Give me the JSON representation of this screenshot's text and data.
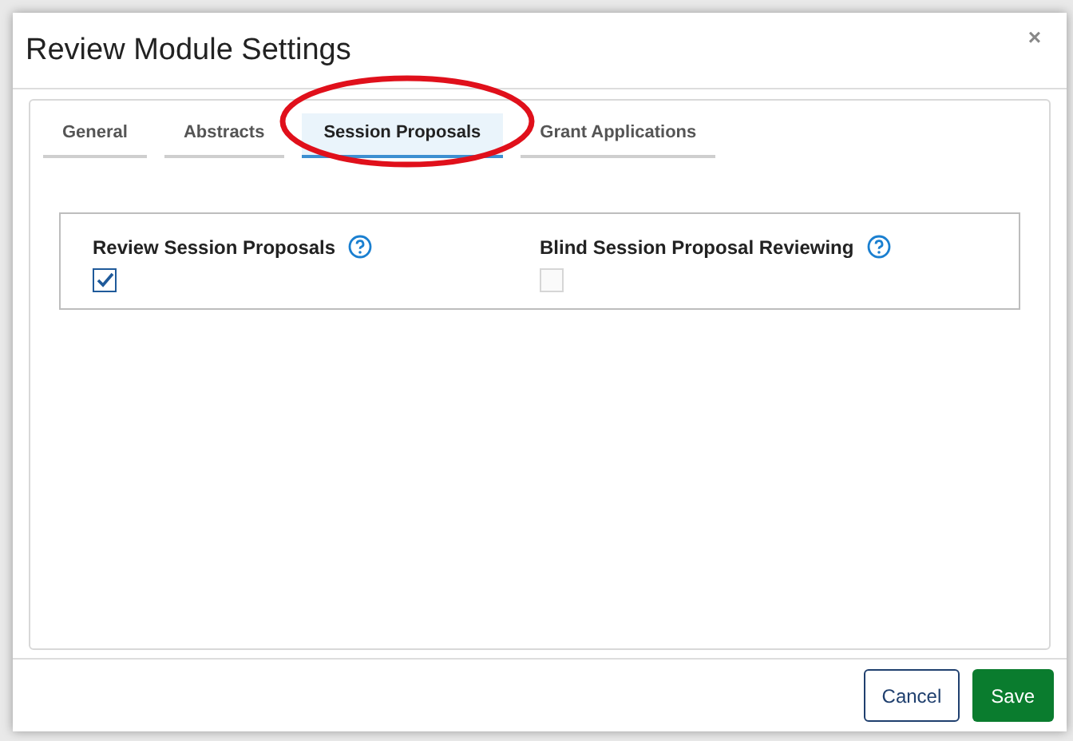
{
  "dialog": {
    "title": "Review Module Settings",
    "close": "×"
  },
  "tabs": [
    {
      "label": "General",
      "selected": false
    },
    {
      "label": "Abstracts",
      "selected": false
    },
    {
      "label": "Session Proposals",
      "selected": true
    },
    {
      "label": "Grant Applications",
      "selected": false
    }
  ],
  "settings": [
    {
      "label": "Review Session Proposals",
      "checked": true,
      "disabled": false
    },
    {
      "label": "Blind Session Proposal Reviewing",
      "checked": false,
      "disabled": true
    }
  ],
  "buttons": [
    {
      "label": "Cancel",
      "kind": "secondary"
    },
    {
      "label": "Save",
      "kind": "primary"
    }
  ]
}
